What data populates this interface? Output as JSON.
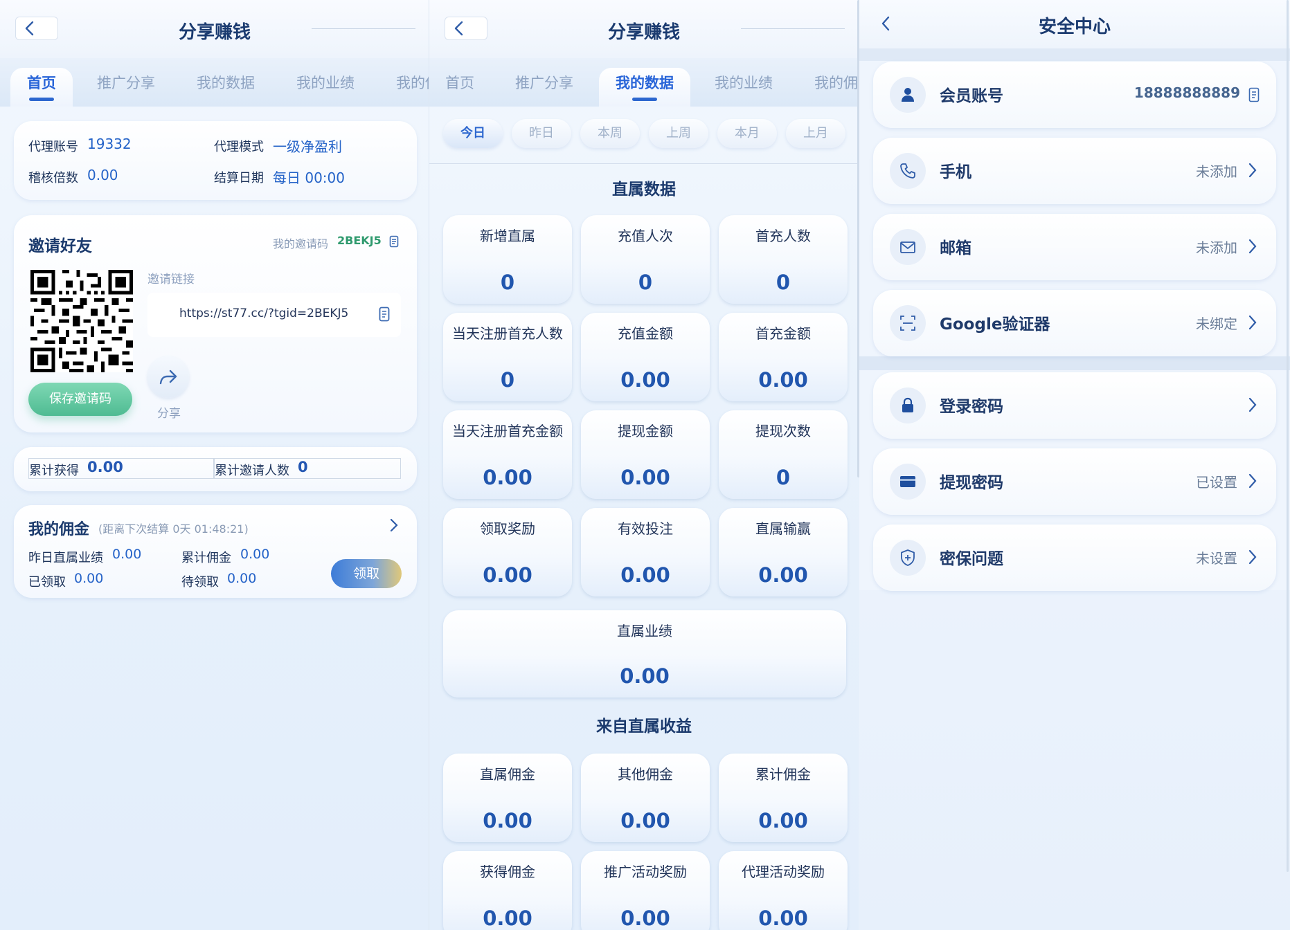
{
  "panel1": {
    "header": {
      "title": "分享赚钱"
    },
    "tabs": [
      "首页",
      "推广分享",
      "我的数据",
      "我的业绩",
      "我的佣"
    ],
    "agent": {
      "account_label": "代理账号",
      "account_value": "19332",
      "mode_label": "代理模式",
      "mode_value": "一级净盈利",
      "ratio_label": "稽核倍数",
      "ratio_value": "0.00",
      "settle_label": "结算日期",
      "settle_value": "每日 00:00"
    },
    "invite": {
      "title": "邀请好友",
      "code_label": "我的邀请码",
      "code_value": "2BEKJ5",
      "link_label": "邀请链接",
      "link_value": "https://st77.cc/?tgid=2BEKJ5",
      "save_label": "保存邀请码",
      "share_label": "分享"
    },
    "totals": {
      "earned_label": "累计获得",
      "earned_value": "0.00",
      "invites_label": "累计邀请人数",
      "invites_value": "0"
    },
    "commission": {
      "title": "我的佣金",
      "countdown": "(距离下次结算 0天 01:48:21)",
      "yesterday_label": "昨日直属业绩",
      "yesterday_value": "0.00",
      "total_label": "累计佣金",
      "total_value": "0.00",
      "received_label": "已领取",
      "received_value": "0.00",
      "pending_label": "待领取",
      "pending_value": "0.00",
      "claim_label": "领取"
    }
  },
  "panel2": {
    "header": {
      "title": "分享赚钱"
    },
    "tabs": [
      "首页",
      "推广分享",
      "我的数据",
      "我的业绩",
      "我的佣"
    ],
    "periods": [
      "今日",
      "昨日",
      "本周",
      "上周",
      "本月",
      "上月"
    ],
    "direct_title": "直属数据",
    "direct": [
      {
        "label": "新增直属",
        "value": "0"
      },
      {
        "label": "充值人次",
        "value": "0"
      },
      {
        "label": "首充人数",
        "value": "0"
      },
      {
        "label": "当天注册首充人数",
        "value": "0"
      },
      {
        "label": "充值金额",
        "value": "0.00"
      },
      {
        "label": "首充金额",
        "value": "0.00"
      },
      {
        "label": "当天注册首充金额",
        "value": "0.00"
      },
      {
        "label": "提现金额",
        "value": "0.00"
      },
      {
        "label": "提现次数",
        "value": "0"
      },
      {
        "label": "领取奖励",
        "value": "0.00"
      },
      {
        "label": "有效投注",
        "value": "0.00"
      },
      {
        "label": "直属输赢",
        "value": "0.00"
      }
    ],
    "performance": {
      "label": "直属业绩",
      "value": "0.00"
    },
    "income_title": "来自直属收益",
    "income": [
      {
        "label": "直属佣金",
        "value": "0.00"
      },
      {
        "label": "其他佣金",
        "value": "0.00"
      },
      {
        "label": "累计佣金",
        "value": "0.00"
      },
      {
        "label": "获得佣金",
        "value": "0.00"
      },
      {
        "label": "推广活动奖励",
        "value": "0.00"
      },
      {
        "label": "代理活动奖励",
        "value": "0.00"
      }
    ]
  },
  "panel3": {
    "header": {
      "title": "安全中心"
    },
    "rows": [
      {
        "label": "会员账号",
        "value": "18888888889"
      },
      {
        "label": "手机",
        "value": "未添加"
      },
      {
        "label": "邮箱",
        "value": "未添加"
      },
      {
        "label": "Google验证器",
        "value": "未绑定"
      },
      {
        "label": "登录密码",
        "value": ""
      },
      {
        "label": "提现密码",
        "value": "已设置"
      },
      {
        "label": "密保问题",
        "value": "未设置"
      }
    ]
  },
  "colors": {
    "accent": "#2965d8",
    "title": "#1b3b70",
    "green": "#3aa079",
    "claim_gradient_start": "#3d7cd8",
    "claim_gradient_end": "#e0c879"
  },
  "icons": [
    "back-arrow-icon",
    "copy-icon",
    "share-arrow-icon",
    "chevron-right-icon",
    "user-icon",
    "phone-icon",
    "mail-icon",
    "scan-icon",
    "lock-icon",
    "card-icon",
    "shield-icon"
  ]
}
